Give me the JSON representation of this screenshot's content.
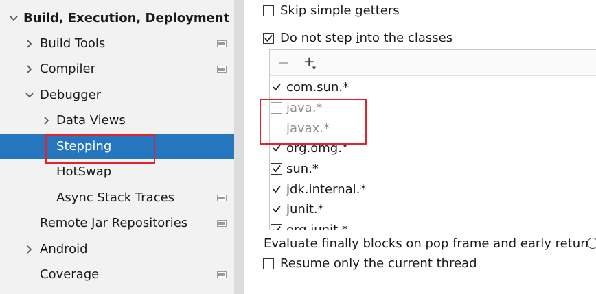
{
  "tree": {
    "items": [
      {
        "label": "Build, Execution, Deployment",
        "expanded": true,
        "icon": "chevron-down-icon",
        "has_page_icon": false
      },
      {
        "label": "Build Tools",
        "icon": "chevron-right-icon",
        "has_page_icon": true
      },
      {
        "label": "Compiler",
        "icon": "chevron-right-icon",
        "has_page_icon": true
      },
      {
        "label": "Debugger",
        "icon": "chevron-down-icon",
        "has_page_icon": false
      },
      {
        "label": "Data Views",
        "icon": "chevron-right-icon",
        "has_page_icon": false
      },
      {
        "label": "Stepping",
        "selected": true,
        "has_page_icon": false
      },
      {
        "label": "HotSwap",
        "has_page_icon": false
      },
      {
        "label": "Async Stack Traces",
        "has_page_icon": true
      },
      {
        "label": "Remote Jar Repositories",
        "has_page_icon": true
      },
      {
        "label": "Android",
        "icon": "chevron-right-icon",
        "has_page_icon": false
      },
      {
        "label": "Coverage",
        "has_page_icon": true
      }
    ],
    "selected_color": "#2675bf"
  },
  "options": {
    "skip_getters": {
      "label_pre": "Skip simple ",
      "label_u": "g",
      "label_post": "etters",
      "checked": false
    },
    "do_not_step": {
      "label_pre": "Do not step ",
      "label_u": "i",
      "label_post": "nto the classes",
      "checked": true
    },
    "evaluate_finally": {
      "label": "Evaluate finally blocks on pop frame and early return:"
    },
    "resume_current": {
      "label": "Resume only the current thread",
      "checked": false
    }
  },
  "class_filters": {
    "toolbar": {
      "remove_icon": "minus-icon",
      "add_icon": "plus-dropdown-icon"
    },
    "items": [
      {
        "pattern": "com.sun.*",
        "checked": true,
        "enabled": true
      },
      {
        "pattern": "java.*",
        "checked": false,
        "enabled": false
      },
      {
        "pattern": "javax.*",
        "checked": false,
        "enabled": false
      },
      {
        "pattern": "org.omg.*",
        "checked": true,
        "enabled": true
      },
      {
        "pattern": "sun.*",
        "checked": true,
        "enabled": true
      },
      {
        "pattern": "jdk.internal.*",
        "checked": true,
        "enabled": true
      },
      {
        "pattern": "junit.*",
        "checked": true,
        "enabled": true
      },
      {
        "pattern": "org.junit.*",
        "checked": true,
        "enabled": true
      }
    ]
  },
  "annotation_color": "#e2232a"
}
